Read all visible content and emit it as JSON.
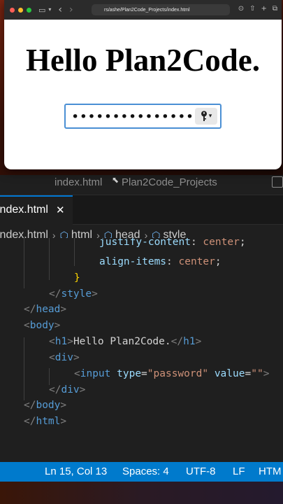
{
  "browser": {
    "url": "rs/ashe/Plan2Code_Projects/index.html",
    "heading": "Hello Plan2Code.",
    "password_value": "••••••••••••••••"
  },
  "editor": {
    "window_title_file": "index.html",
    "window_title_folder": "Plan2Code_Projects",
    "tab_label": "index.html",
    "breadcrumb": [
      "index.html",
      "html",
      "head",
      "style"
    ]
  },
  "code": {
    "css_prop_1": "justify-content",
    "css_val_1": "center",
    "css_prop_2": "align-items",
    "css_val_2": "center",
    "close_brace": "}",
    "tag_style": "style",
    "tag_head": "head",
    "tag_body": "body",
    "tag_h1": "h1",
    "h1_text": "Hello Plan2Code.",
    "tag_div": "div",
    "tag_input": "input",
    "attr_type": "type",
    "attr_type_value": "\"password\"",
    "attr_value": "value",
    "attr_value_value": "\"\"",
    "tag_html": "html"
  },
  "status": {
    "position": "Ln 15, Col 13",
    "spaces": "Spaces: 4",
    "encoding": "UTF-8",
    "eol": "LF",
    "language": "HTM"
  }
}
